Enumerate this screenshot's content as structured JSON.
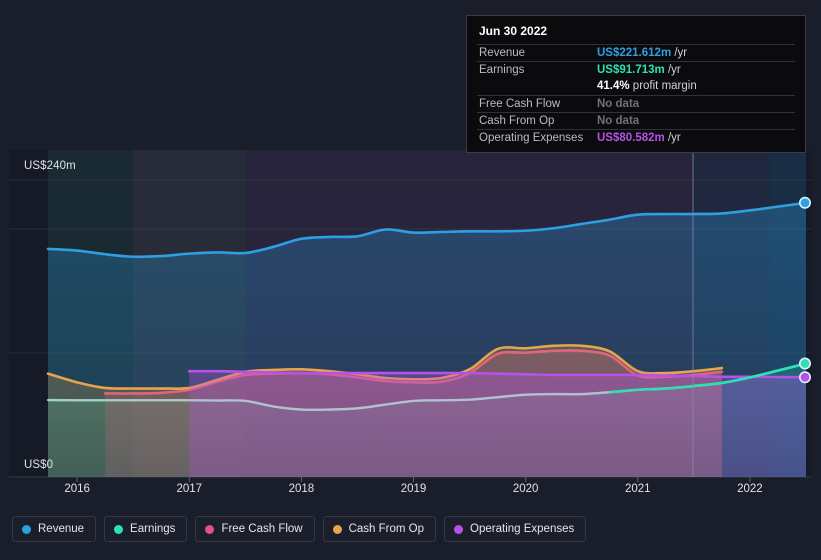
{
  "chart_data": {
    "type": "area",
    "title": "",
    "xlabel": "",
    "ylabel": "",
    "ylim": [
      0,
      240
    ],
    "y_ticks": [
      "US$0",
      "US$240m"
    ],
    "y_tick_values": [
      0,
      240
    ],
    "grid": true,
    "currency": "US$",
    "unit": "m",
    "x_categories": [
      "2016",
      "2017",
      "2018",
      "2019",
      "2020",
      "2021",
      "2022"
    ],
    "x_tick_values": [
      2016,
      2017,
      2018,
      2019,
      2020,
      2021,
      2022
    ],
    "x_range": [
      2015.74,
      2022.5
    ],
    "legend_position": "bottom",
    "series": [
      {
        "name": "Revenue",
        "color": "#2f9fe3",
        "x": [
          2015.74,
          2016.0,
          2016.25,
          2016.5,
          2016.75,
          2017.0,
          2017.25,
          2017.5,
          2017.75,
          2018.0,
          2018.25,
          2018.5,
          2018.75,
          2019.0,
          2019.25,
          2019.5,
          2019.75,
          2020.0,
          2020.25,
          2020.5,
          2020.75,
          2021.0,
          2021.25,
          2021.5,
          2021.75,
          2022.0,
          2022.25,
          2022.5
        ],
        "values": [
          184.3,
          183.0,
          180.0,
          178.0,
          178.5,
          180.5,
          181.5,
          181.0,
          186.0,
          192.5,
          194.0,
          194.5,
          200.0,
          197.5,
          198.0,
          198.5,
          198.5,
          199.0,
          201.0,
          204.5,
          208.0,
          212.0,
          212.5,
          212.5,
          213.0,
          215.5,
          218.5,
          221.6
        ],
        "end_value": 221.612,
        "end_label": "US$221.612m"
      },
      {
        "name": "Earnings",
        "color": "#2ee0b4",
        "x": [
          2015.74,
          2016.0,
          2016.25,
          2016.5,
          2016.75,
          2017.0,
          2017.25,
          2017.5,
          2017.75,
          2018.0,
          2018.25,
          2018.5,
          2018.75,
          2019.0,
          2019.25,
          2019.5,
          2019.75,
          2020.0,
          2020.25,
          2020.5,
          2020.75,
          2021.0,
          2021.25,
          2021.5,
          2021.75,
          2022.0,
          2022.25,
          2022.5
        ],
        "values": [
          62.2,
          62.0,
          62.0,
          62.0,
          62.0,
          62.0,
          61.8,
          61.5,
          57.0,
          54.5,
          54.5,
          55.5,
          58.5,
          61.5,
          62.0,
          62.5,
          64.5,
          66.5,
          67.0,
          67.0,
          68.5,
          70.5,
          71.5,
          73.5,
          76.0,
          80.5,
          86.0,
          91.7
        ],
        "end_value": 91.713,
        "end_label": "US$91.713m"
      },
      {
        "name": "Free Cash Flow",
        "color": "#e0518a",
        "x": [
          2016.25,
          2016.5,
          2016.75,
          2017.0,
          2017.25,
          2017.5,
          2017.75,
          2018.0,
          2018.25,
          2018.5,
          2018.75,
          2019.0,
          2019.25,
          2019.5,
          2019.75,
          2020.0,
          2020.25,
          2020.5,
          2020.75,
          2021.0,
          2021.25,
          2021.5,
          2021.75
        ],
        "values": [
          67.5,
          67.5,
          68.0,
          70.5,
          77.0,
          82.5,
          83.5,
          84.0,
          83.0,
          80.5,
          77.5,
          76.5,
          77.0,
          84.0,
          99.5,
          100.5,
          102.0,
          102.0,
          98.0,
          82.0,
          81.0,
          82.5,
          85.0
        ],
        "end_value": null,
        "end_label": "No data"
      },
      {
        "name": "Cash From Op",
        "color": "#e7a44c",
        "x": [
          2015.74,
          2016.0,
          2016.25,
          2016.5,
          2016.75,
          2017.0,
          2017.25,
          2017.5,
          2017.75,
          2018.0,
          2018.25,
          2018.5,
          2018.75,
          2019.0,
          2019.25,
          2019.5,
          2019.75,
          2020.0,
          2020.25,
          2020.5,
          2020.75,
          2021.0,
          2021.25,
          2021.5,
          2021.75
        ],
        "values": [
          83.5,
          76.5,
          72.0,
          71.5,
          71.5,
          72.0,
          78.5,
          85.0,
          86.5,
          87.0,
          85.5,
          83.0,
          80.0,
          79.0,
          80.0,
          87.0,
          103.5,
          104.0,
          106.0,
          106.0,
          101.5,
          85.5,
          84.0,
          85.5,
          88.0
        ],
        "end_value": null,
        "end_label": "No data"
      },
      {
        "name": "Operating Expenses",
        "color": "#b752e8",
        "x": [
          2017.0,
          2017.25,
          2017.5,
          2017.75,
          2018.0,
          2018.25,
          2018.5,
          2018.75,
          2019.0,
          2019.25,
          2019.5,
          2019.75,
          2020.0,
          2020.25,
          2020.5,
          2020.75,
          2021.0,
          2021.25,
          2021.5,
          2021.75,
          2022.0,
          2022.25,
          2022.5
        ],
        "values": [
          85.5,
          85.5,
          85.0,
          84.5,
          84.0,
          84.0,
          84.0,
          84.0,
          84.0,
          84.0,
          84.0,
          83.5,
          83.0,
          82.5,
          82.5,
          82.5,
          82.5,
          82.0,
          81.5,
          81.0,
          81.0,
          80.8,
          80.6
        ],
        "end_value": 80.582,
        "end_label": "US$80.582m"
      }
    ]
  },
  "y_axis": {
    "top_label": "US$240m",
    "zero_label": "US$0"
  },
  "x_axis": {
    "ticks": [
      "2016",
      "2017",
      "2018",
      "2019",
      "2020",
      "2021",
      "2022"
    ]
  },
  "tooltip": {
    "date": "Jun 30 2022",
    "rows": [
      {
        "key": "Revenue",
        "value": "US$221.612m",
        "suffix": " /yr",
        "color": "#2f9fe3",
        "nodata": false
      },
      {
        "key": "Earnings",
        "value": "US$91.713m",
        "suffix": " /yr",
        "color": "#2ee0b4",
        "nodata": false
      },
      {
        "key": "",
        "value": "41.4%",
        "suffix": " profit margin",
        "color": "#ffffff",
        "nodata": false
      },
      {
        "key": "Free Cash Flow",
        "value": "No data",
        "suffix": "",
        "color": "#6f727a",
        "nodata": true
      },
      {
        "key": "Cash From Op",
        "value": "No data",
        "suffix": "",
        "color": "#6f727a",
        "nodata": true
      },
      {
        "key": "Operating Expenses",
        "value": "US$80.582m",
        "suffix": " /yr",
        "color": "#b752e8",
        "nodata": false
      }
    ]
  },
  "legend": {
    "items": [
      {
        "label": "Revenue",
        "color": "#2f9fe3"
      },
      {
        "label": "Earnings",
        "color": "#2ee0b4"
      },
      {
        "label": "Free Cash Flow",
        "color": "#e0518a"
      },
      {
        "label": "Cash From Op",
        "color": "#e7a44c"
      },
      {
        "label": "Operating Expenses",
        "color": "#b752e8"
      }
    ]
  },
  "colors": {
    "background": "#1a1e2b",
    "plot_background": "#151a26",
    "gridline": "#3b4150",
    "revenue": "#2f9fe3",
    "earnings": "#2ee0b4",
    "free_cash_flow": "#e0518a",
    "cash_from_op": "#e7a44c",
    "operating_expenses": "#b752e8"
  }
}
